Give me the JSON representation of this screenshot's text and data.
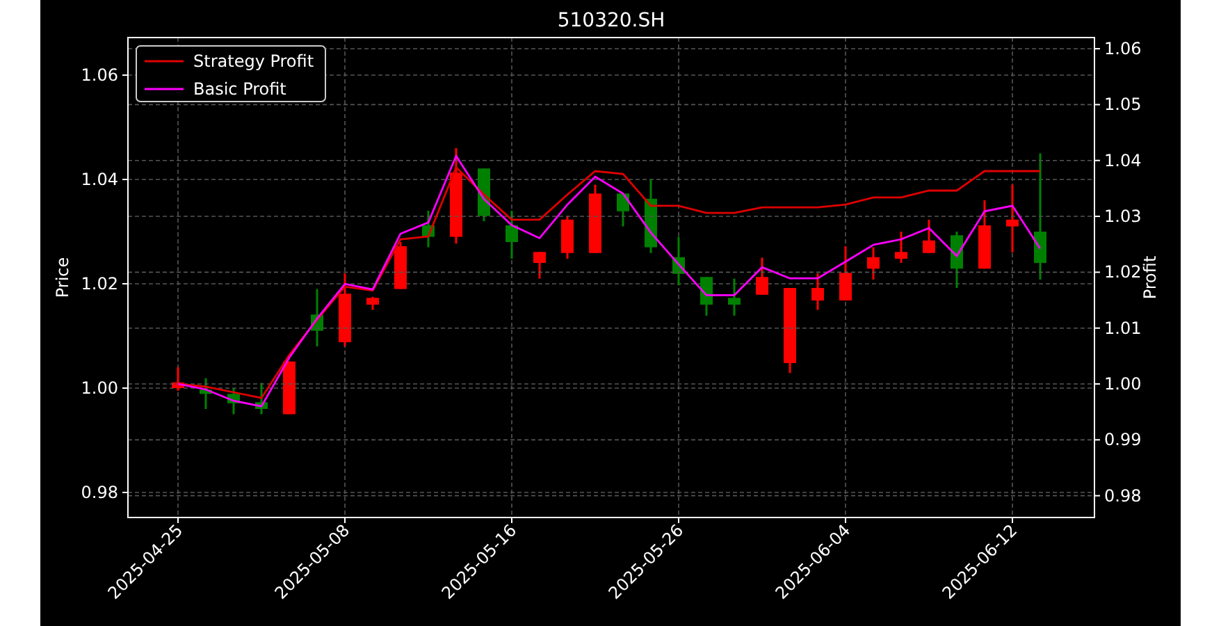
{
  "price_chart": {
    "chart_data": {
      "type": "candlestick",
      "title": "510320.SH",
      "ylabel": "Price",
      "grid": true,
      "categories": [
        "2025-04-25",
        null,
        null,
        null,
        null,
        null,
        "2025-05-08",
        null,
        null,
        null,
        null,
        null,
        "2025-05-16",
        null,
        null,
        null,
        null,
        null,
        "2025-05-26",
        null,
        null,
        null,
        null,
        null,
        "2025-06-04",
        null,
        null,
        null,
        null,
        null,
        "2025-06-12",
        null
      ],
      "ylim": [
        0.9752,
        1.0672
      ],
      "yticks": [
        {
          "value": 0.98,
          "label": "0.98"
        },
        {
          "value": 1.0,
          "label": "1.00"
        },
        {
          "value": 1.02,
          "label": "1.02"
        },
        {
          "value": 1.04,
          "label": "1.04"
        },
        {
          "value": 1.06,
          "label": "1.06"
        }
      ],
      "ohlc": [
        [
          1.0,
          1.004,
          0.9995,
          1.0011
        ],
        [
          0.9997,
          1.0019,
          0.996,
          0.9989
        ],
        [
          0.9989,
          1.0,
          0.995,
          0.9971
        ],
        [
          0.9973,
          1.001,
          0.995,
          0.996
        ],
        [
          0.995,
          1.0051,
          0.995,
          1.0051
        ],
        [
          1.0141,
          1.019,
          1.008,
          1.011
        ],
        [
          1.0088,
          1.022,
          1.008,
          1.0181
        ],
        [
          1.016,
          1.0175,
          1.015,
          1.0173
        ],
        [
          1.019,
          1.028,
          1.019,
          1.0272
        ],
        [
          1.0312,
          1.034,
          1.027,
          1.029
        ],
        [
          1.029,
          1.046,
          1.0277,
          1.0413
        ],
        [
          1.0421,
          1.0421,
          1.032,
          1.033
        ],
        [
          1.0312,
          1.034,
          1.0248,
          1.028
        ],
        [
          1.024,
          1.0261,
          1.021,
          1.0261
        ],
        [
          1.0259,
          1.033,
          1.0248,
          1.0323
        ],
        [
          1.0259,
          1.039,
          1.0259,
          1.0373
        ],
        [
          1.0373,
          1.0373,
          1.031,
          1.0339
        ],
        [
          1.0363,
          1.04,
          1.0259,
          1.027
        ],
        [
          1.0251,
          1.029,
          1.0197,
          1.0219
        ],
        [
          1.0213,
          1.0213,
          1.0139,
          1.016
        ],
        [
          1.0173,
          1.021,
          1.0139,
          1.016
        ],
        [
          1.0179,
          1.025,
          1.0179,
          1.0213
        ],
        [
          1.0048,
          1.0192,
          1.0029,
          1.0192
        ],
        [
          1.0168,
          1.022,
          1.015,
          1.0192
        ],
        [
          1.0168,
          1.0272,
          1.0168,
          1.0221
        ],
        [
          1.0229,
          1.027,
          1.0208,
          1.0251
        ],
        [
          1.0248,
          1.03,
          1.024,
          1.0261
        ],
        [
          1.0259,
          1.0323,
          1.0259,
          1.0283
        ],
        [
          1.0293,
          1.03,
          1.0192,
          1.0229
        ],
        [
          1.0229,
          1.036,
          1.0229,
          1.0312
        ],
        [
          1.031,
          1.039,
          1.026,
          1.0323
        ],
        [
          1.03,
          1.045,
          1.0208,
          1.024
        ]
      ]
    }
  },
  "profit_chart": {
    "chart_data": {
      "type": "line",
      "ylabel": "Profit",
      "grid": true,
      "legend": "upper left",
      "categories": [
        null,
        null,
        null,
        null,
        null,
        null,
        null,
        null,
        null,
        null,
        null,
        null,
        null,
        null,
        null,
        null,
        null,
        null,
        null,
        null,
        null,
        null,
        null,
        null,
        null,
        null,
        null,
        null,
        null,
        null,
        null,
        null
      ],
      "ylim": [
        0.9761,
        1.062
      ],
      "yticks": [
        {
          "value": 0.98,
          "label": "0.98"
        },
        {
          "value": 0.99,
          "label": "0.99"
        },
        {
          "value": 1.0,
          "label": "1.00"
        },
        {
          "value": 1.01,
          "label": "1.01"
        },
        {
          "value": 1.02,
          "label": "1.02"
        },
        {
          "value": 1.03,
          "label": "1.03"
        },
        {
          "value": 1.04,
          "label": "1.04"
        },
        {
          "value": 1.05,
          "label": "1.05"
        },
        {
          "value": 1.06,
          "label": "1.06"
        }
      ],
      "series": [
        {
          "name": "Strategy Profit",
          "color": "#e00000",
          "values": [
            1.0,
            0.9995,
            0.9985,
            0.9975,
            1.0052,
            1.0115,
            1.0174,
            1.0167,
            1.0259,
            1.0264,
            1.0388,
            1.0339,
            1.0294,
            1.0294,
            1.0339,
            1.0381,
            1.0376,
            1.0319,
            1.0319,
            1.0306,
            1.0306,
            1.0316,
            1.0316,
            1.0316,
            1.0321,
            1.0334,
            1.0334,
            1.0346,
            1.0346,
            1.0381,
            1.0381,
            1.0381
          ]
        },
        {
          "name": "Basic Profit",
          "color": "#ff00ff",
          "values": [
            1.0,
            0.999,
            0.997,
            0.996,
            1.0047,
            1.0117,
            1.0179,
            1.0169,
            1.0269,
            1.0289,
            1.0408,
            1.0331,
            1.0284,
            1.0261,
            1.0321,
            1.0371,
            1.0341,
            1.0271,
            1.0214,
            1.0159,
            1.0159,
            1.0209,
            1.0189,
            1.0189,
            1.0219,
            1.0249,
            1.0259,
            1.0279,
            1.0229,
            1.0309,
            1.0319,
            1.0242
          ]
        }
      ]
    }
  }
}
